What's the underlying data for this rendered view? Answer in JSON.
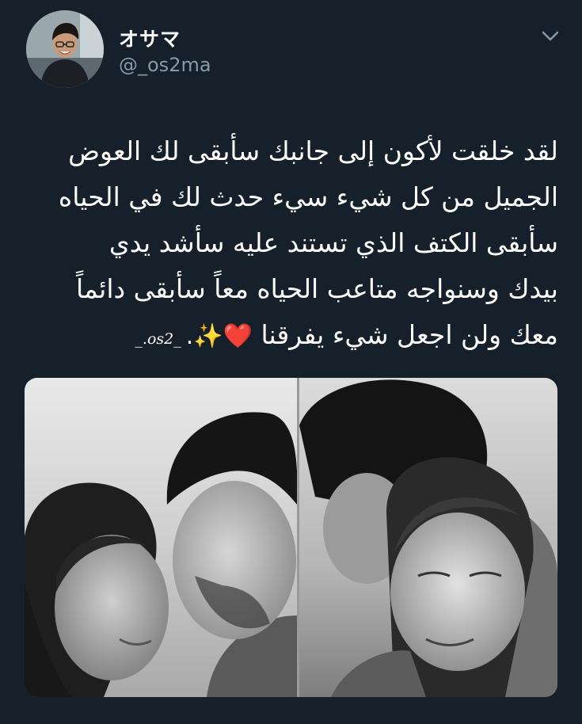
{
  "tweet": {
    "author": {
      "display_name": "オサマ",
      "handle": "@_os2ma"
    },
    "text_lines": [
      "لقد خلقت لأكون إلى جانبك سأبقى لك العوض",
      "الجميل من كل شيء سيء حدث لك في الحياه",
      "سأبقى الكتف الذي تستند عليه سأشد يدي",
      "بيدك وسنواجه متاعب الحياه معاً سأبقى دائماً",
      "معك ولن اجعل شيء يفرقنا"
    ],
    "emoji": "❤️✨.",
    "signature": "_.os2_",
    "icons": {
      "menu": "chevron-down-icon"
    },
    "colors": {
      "background": "#15202b",
      "name": "#ffffff",
      "handle": "#8899a6",
      "text": "#ffffff"
    }
  }
}
